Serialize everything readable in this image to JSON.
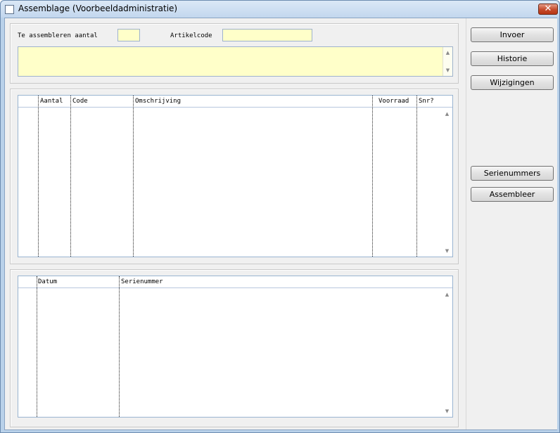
{
  "window": {
    "title": "Assemblage (Voorbeeldadministratie)",
    "close_symbol": "✕"
  },
  "form": {
    "quantity_label": "Te assembleren aantal",
    "quantity_value": "",
    "article_code_label": "Artikelcode",
    "article_code_value": "",
    "description_value": "",
    "input_color": "#ffffc9"
  },
  "components_grid": {
    "columns": [
      "",
      "Aantal",
      "Code",
      "Omschrijving",
      "Voorraad",
      "Snr?"
    ],
    "rows": []
  },
  "serial_grid": {
    "columns": [
      "",
      "Datum",
      "Serienummer"
    ],
    "rows": []
  },
  "buttons": {
    "invoer": "Invoer",
    "historie": "Historie",
    "wijzigingen": "Wijzigingen",
    "serienummers": "Serienummers",
    "assembleer": "Assembleer"
  },
  "icons": {
    "scroll_up": "▲",
    "scroll_down": "▼"
  }
}
